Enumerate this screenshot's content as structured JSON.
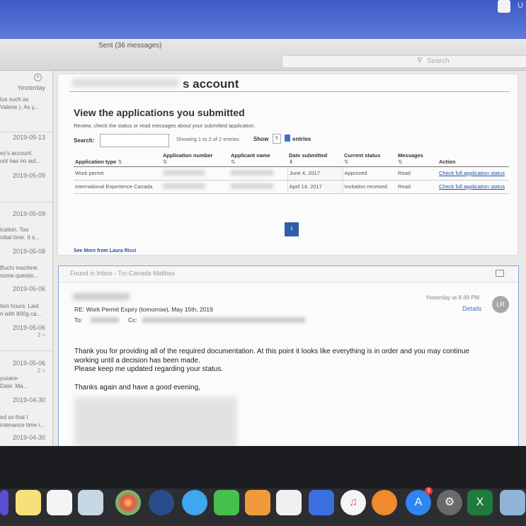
{
  "screen": {
    "corner_text": "U"
  },
  "window": {
    "title": "Sent (36 messages)",
    "search_placeholder": "Search"
  },
  "message_list": [
    {
      "date": "Yesterday",
      "lines": [
        "tus such as",
        "Valerie ). As y..."
      ]
    },
    {
      "date": "2019-05-13",
      "lines": [
        "ey's account",
        "unt has no aut..."
      ]
    },
    {
      "date": "2019-05-09",
      "lines": []
    },
    {
      "date": "2019-05-09",
      "lines": [
        "ication. Too",
        "nitial time. It s..."
      ]
    },
    {
      "date": "2019-05-08",
      "lines": [
        "Buchi machine.",
        "some questio..."
      ]
    },
    {
      "date": "2019-05-06",
      "lines": [
        "tion hours. Last",
        "n with 800g ca..."
      ]
    },
    {
      "date": "2019-05-06",
      "thread": "3 >",
      "lines": []
    },
    {
      "date": "2019-05-06",
      "thread": "2 >",
      "lines": [
        "yusare-",
        "Date: Ma..."
      ]
    },
    {
      "date": "2019-04-30",
      "lines": [
        "ed so that I",
        "intenance time i..."
      ]
    },
    {
      "date": "2019-04-30",
      "lines": []
    }
  ],
  "account_card": {
    "title": "s account",
    "heading": "View the applications you submitted",
    "subtitle": "Review, check the status or read messages about your submitted application.",
    "search_label": "Search:",
    "showing": "Showing 1 to 2 of 2 entries",
    "show_label": "Show",
    "show_value": "5",
    "entries_label": "entries",
    "columns": [
      "Application type",
      "Application number",
      "Applicant name",
      "Date submitted",
      "Current status",
      "Messages",
      "Action"
    ],
    "rows": [
      {
        "type": "Work permit",
        "date": "June 4, 2017",
        "status": "Approved",
        "messages": "Read",
        "action": "Check full application status"
      },
      {
        "type": "International Experience Canada",
        "date": "April 14, 2017",
        "status": "Invitation received",
        "messages": "Read",
        "action": "Check full application status"
      }
    ],
    "page": "1",
    "see_more": "See More from Laura Ricci"
  },
  "email": {
    "found_in": "Found in Inbox - Trc-Canada Mailbox",
    "timestamp": "Yesterday at 8:49 PM",
    "details": "Details",
    "avatar": "LR",
    "subject": "RE: Work Permit Expiry (tomorrow), May 15th, 2019",
    "to_label": "To:",
    "cc_label": "Cc:",
    "body": [
      "Thank you for providing all of the required documentation. At this point it looks like everything is in order and you may continue working until a decision has been made.",
      "Please keep me updated regarding your status.",
      "Thanks again and have a good evening,"
    ]
  },
  "dock": {
    "appstore_badge": "3",
    "excel_letter": "X"
  }
}
